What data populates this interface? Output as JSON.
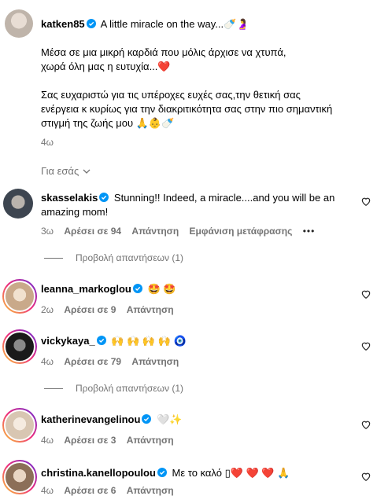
{
  "post": {
    "username": "katken85",
    "caption_title": "A little miracle on the way...",
    "paragraph1_line1": "Μέσα σε μια μικρή καρδιά που μόλις άρχισε να χτυπά,",
    "paragraph1_line2": "χωρά όλη μας η ευτυχία...",
    "paragraph2_line1": "Σας ευχαριστώ για τις υπέροχες ευχές σας,την θετική σας",
    "paragraph2_line2": "ενέργεια κ κυρίως για την διακριτικότητα σας στην πιο σημαντική",
    "paragraph2_line3": "στιγμή της ζωής μου",
    "time": "4ω"
  },
  "for_you_label": "Για εσάς",
  "comments": [
    {
      "username": "skasselakis",
      "verified": true,
      "text_line1": "Stunning!! Indeed, a miracle....and you will be an",
      "text_line2": "amazing mom!",
      "time": "3ω",
      "likes": "Αρέσει σε 94",
      "reply": "Απάντηση",
      "translate": "Εμφάνιση μετάφρασης",
      "more": "•••",
      "view_replies": "Προβολή απαντήσεων (1)"
    },
    {
      "username": "leanna_markoglou",
      "verified": true,
      "text": "🤩 🤩",
      "time": "2ω",
      "likes": "Αρέσει σε 9",
      "reply": "Απάντηση"
    },
    {
      "username": "vickykaya_",
      "verified": true,
      "text": "🙌 🙌 🙌 🙌 🧿",
      "time": "4ω",
      "likes": "Αρέσει σε 79",
      "reply": "Απάντηση",
      "view_replies": "Προβολή απαντήσεων (1)"
    },
    {
      "username": "katherinevangelinou",
      "verified": true,
      "text": "🤍✨",
      "time": "4ω",
      "likes": "Αρέσει σε 3",
      "reply": "Απάντηση"
    },
    {
      "username": "christina.kanellopoulou",
      "verified": true,
      "text": "Με το καλό",
      "text_emoji": "▯❤️ ❤️ ❤️ 🙏",
      "time": "4ω",
      "likes": "Αρέσει σε 6",
      "reply": "Απάντηση"
    }
  ],
  "colors": {
    "verified": "#0095f6",
    "secondary": "#737373",
    "heart_red": "#ed4956"
  }
}
